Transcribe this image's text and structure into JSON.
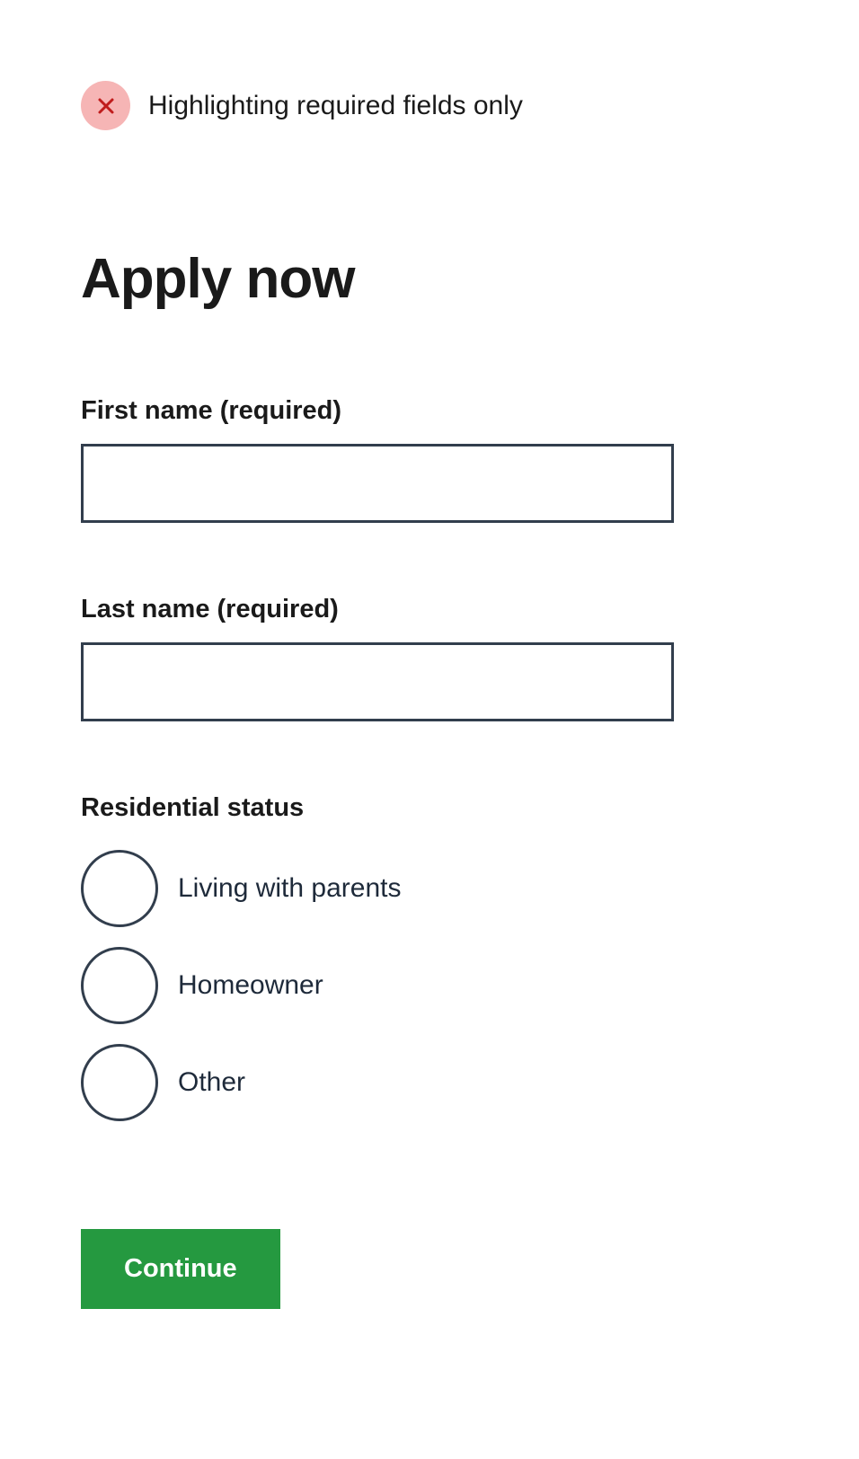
{
  "note": {
    "text": "Highlighting required fields only"
  },
  "page": {
    "title": "Apply now"
  },
  "form": {
    "first_name_label": "First name (required)",
    "first_name_value": "",
    "last_name_label": "Last name (required)",
    "last_name_value": "",
    "residential_status_label": "Residential status",
    "residential_options": [
      "Living with parents",
      "Homeowner",
      "Other"
    ]
  },
  "actions": {
    "continue_label": "Continue"
  }
}
